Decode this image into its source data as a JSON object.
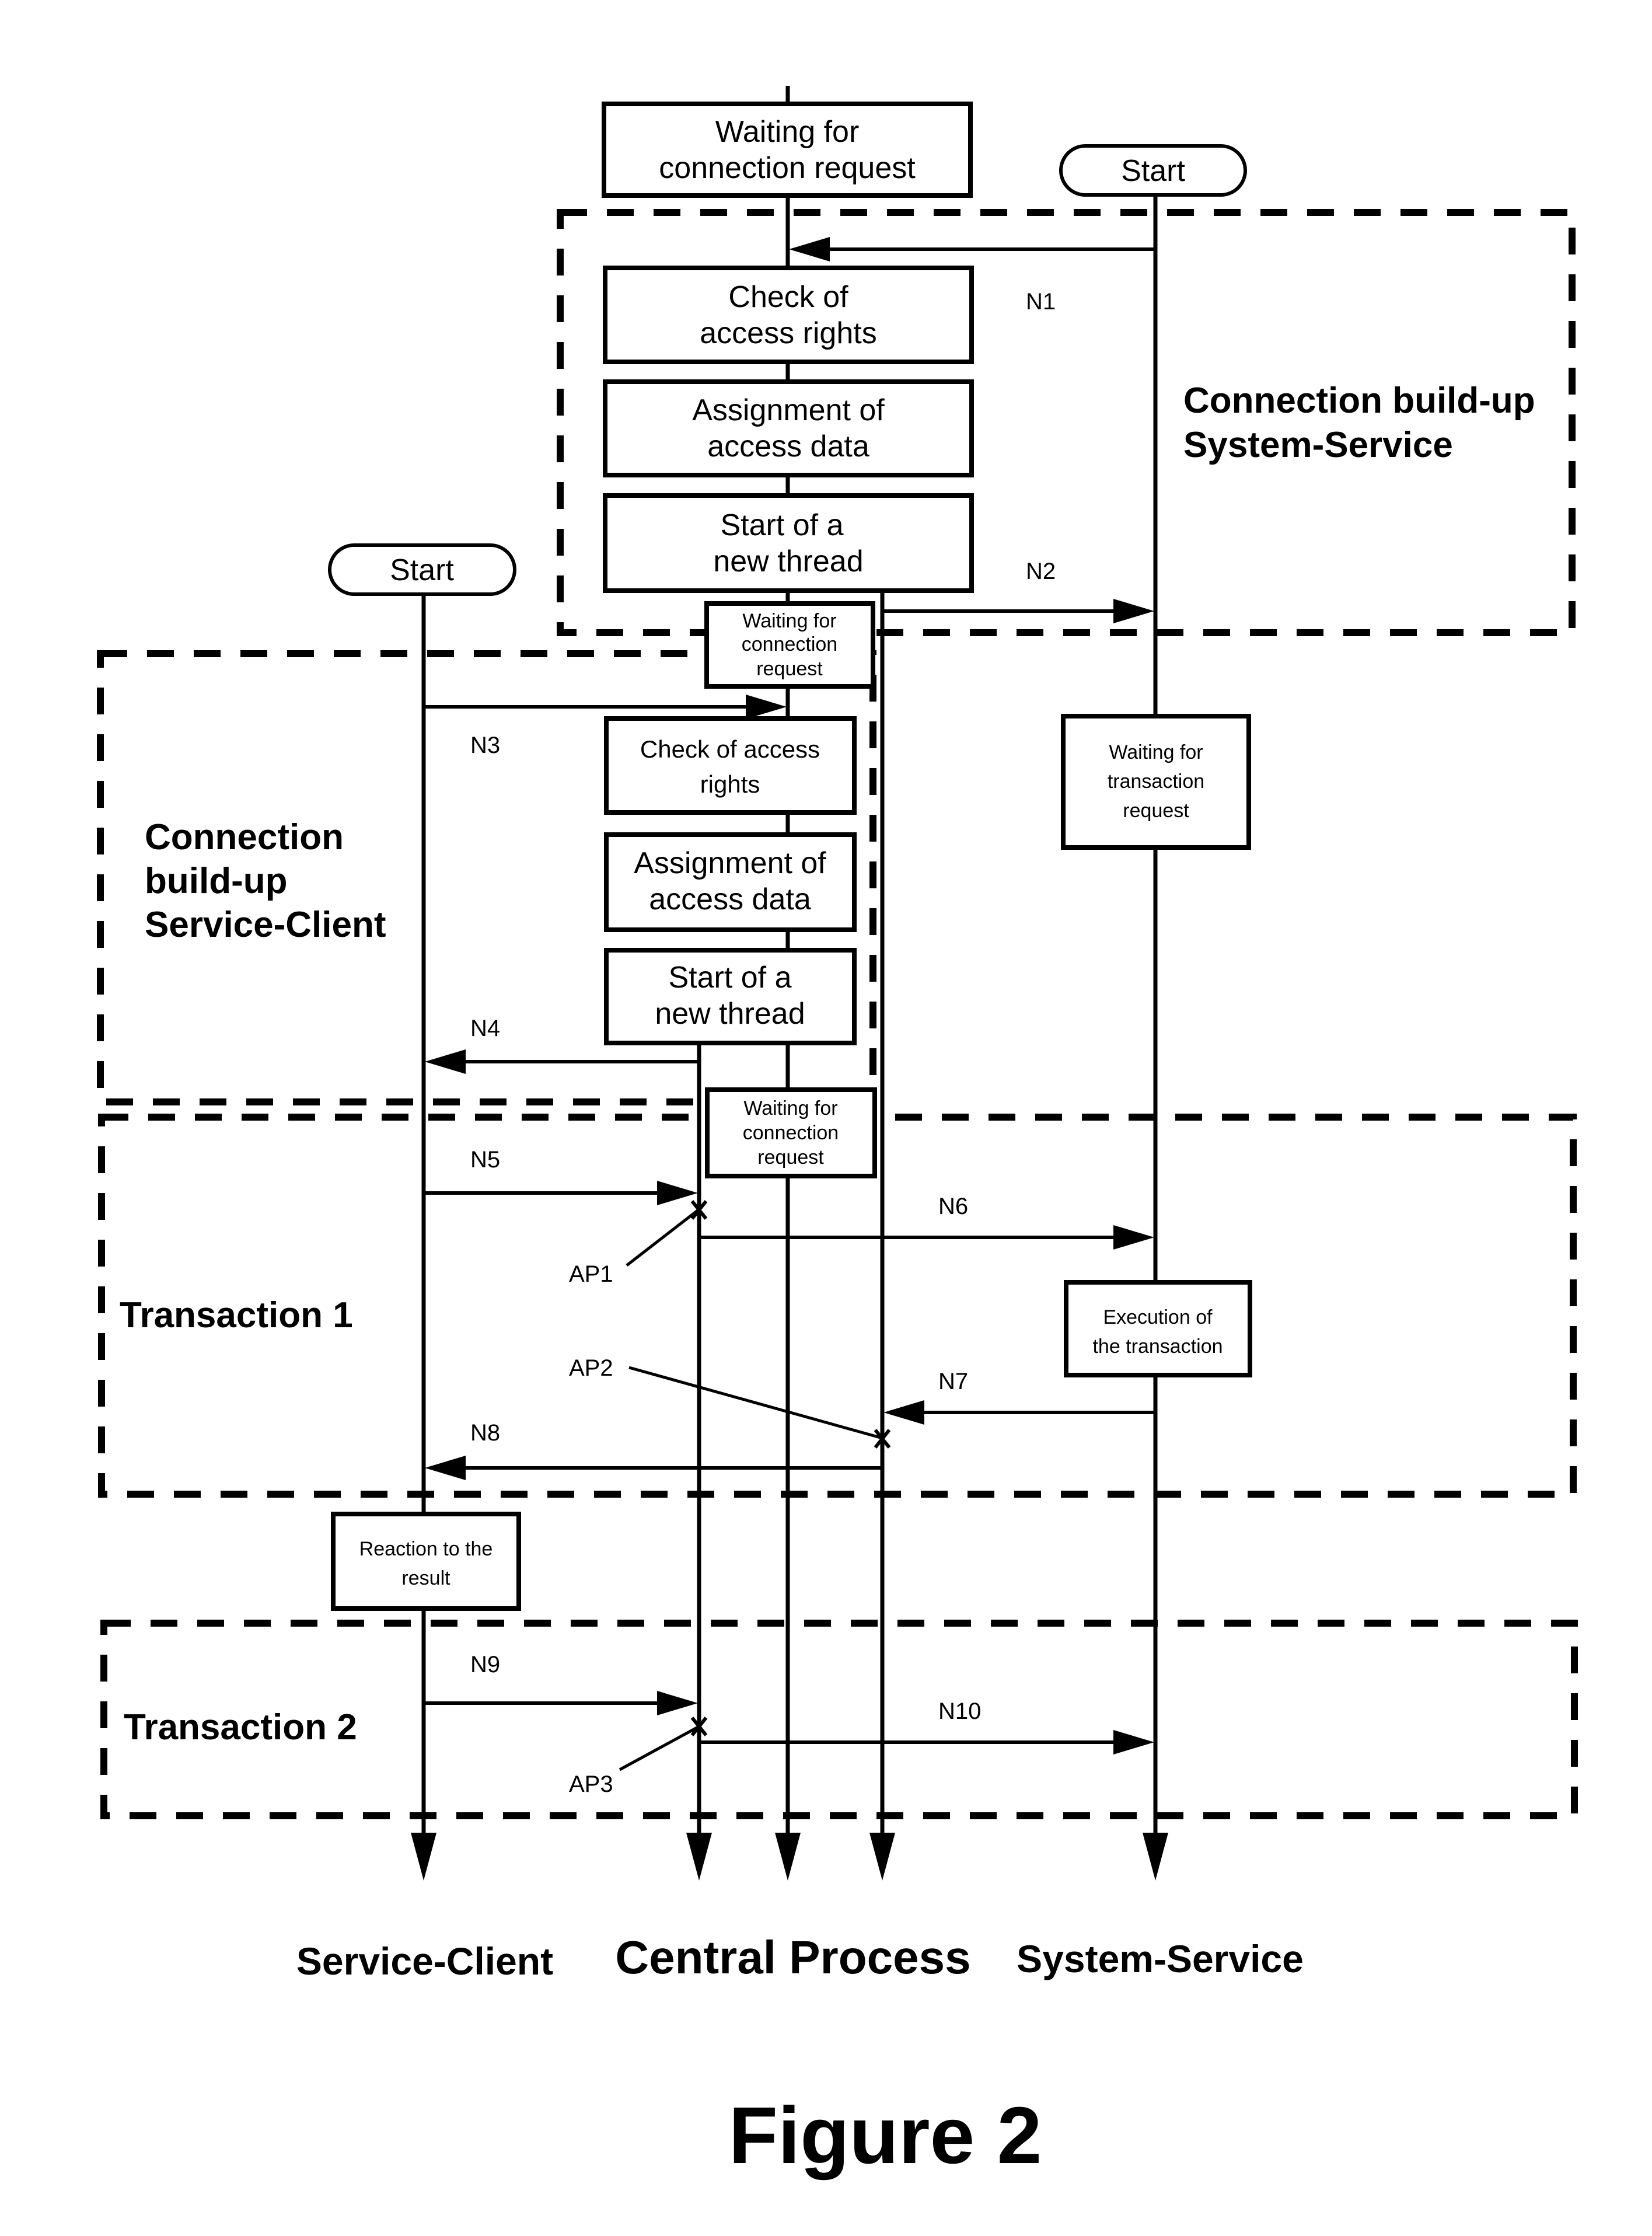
{
  "figure_title": "Figure 2",
  "lanes": {
    "service_client": "Service-Client",
    "central_process": "Central Process",
    "system_service": "System-Service"
  },
  "start_labels": {
    "system_service": "Start",
    "service_client": "Start"
  },
  "sections": {
    "conn_system_service": [
      "Connection build-up",
      "System-Service"
    ],
    "conn_service_client": [
      "Connection",
      "build-up",
      "Service-Client"
    ],
    "transaction1": "Transaction 1",
    "transaction2": "Transaction 2"
  },
  "boxes": {
    "wait_conn_1": [
      "Waiting for",
      "connection request"
    ],
    "check_rights_1": [
      "Check of",
      "access rights"
    ],
    "assign_data_1": [
      "Assignment of",
      "access data"
    ],
    "start_thread_1": [
      "Start of a",
      "new thread"
    ],
    "wait_conn_2": [
      "Waiting for",
      "connection",
      "request"
    ],
    "check_rights_2": [
      "Check of access",
      "rights"
    ],
    "assign_data_2": [
      "Assignment of",
      "access data"
    ],
    "start_thread_2": [
      "Start of a",
      "new thread"
    ],
    "wait_conn_3": [
      "Waiting for",
      "connection",
      "request"
    ],
    "wait_transaction": [
      "Waiting for",
      "transaction",
      "request"
    ],
    "execution": [
      "Execution of",
      "the transaction"
    ],
    "reaction": [
      "Reaction to the",
      "result"
    ]
  },
  "messages": {
    "n1": "N1",
    "n2": "N2",
    "n3": "N3",
    "n4": "N4",
    "n5": "N5",
    "n6": "N6",
    "n7": "N7",
    "n8": "N8",
    "n9": "N9",
    "n10": "N10"
  },
  "access_points": {
    "ap1": "AP1",
    "ap2": "AP2",
    "ap3": "AP3"
  }
}
